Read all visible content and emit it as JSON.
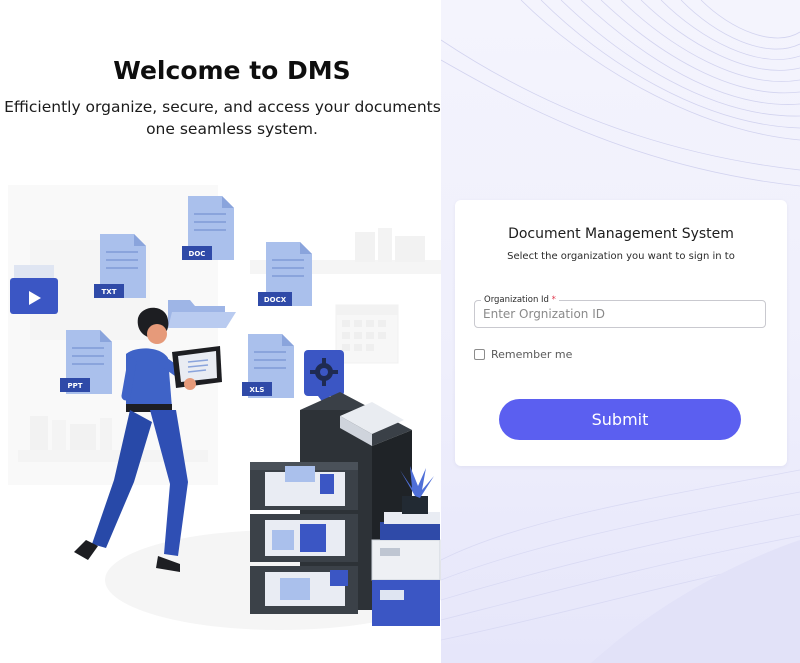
{
  "hero": {
    "title": "Welcome to DMS",
    "subtitle_line1": "Efficiently organize, secure, and access your documents in",
    "subtitle_line2": "one seamless system."
  },
  "illustration": {
    "file_labels": [
      "DOC",
      "TXT",
      "DOCX",
      "PPT",
      "XLS"
    ]
  },
  "login": {
    "title": "Document Management System",
    "subtitle": "Select the organization you want to sign in to",
    "org_field": {
      "label": "Organization Id",
      "required_mark": "*",
      "placeholder": "Enter Orgnization ID",
      "value": ""
    },
    "remember_label": "Remember me",
    "remember_checked": false,
    "submit_label": "Submit"
  },
  "colors": {
    "accent": "#5b5ff0",
    "right_panel_bg": "#f1f1fc",
    "required": "#e0374b",
    "illustration_blue": "#3b56c4"
  }
}
